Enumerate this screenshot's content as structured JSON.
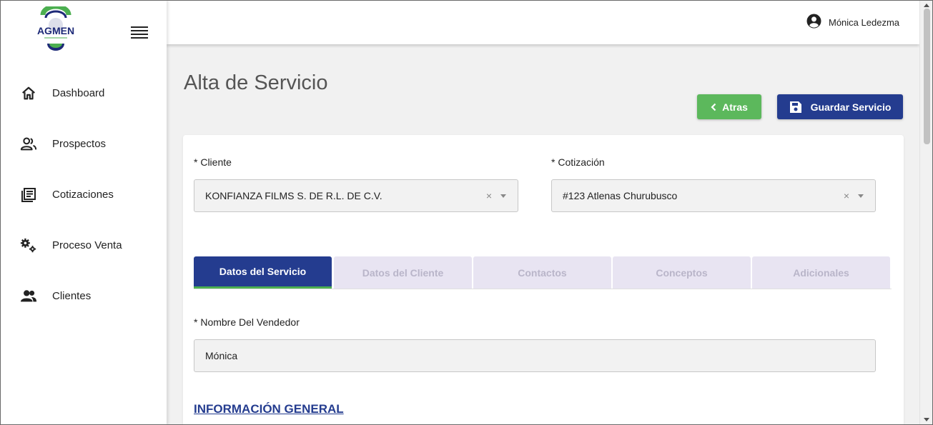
{
  "sidebar": {
    "logo_text": "AGMEN",
    "items": [
      {
        "label": "Dashboard",
        "icon": "home-icon"
      },
      {
        "label": "Prospectos",
        "icon": "people-outline-icon"
      },
      {
        "label": "Cotizaciones",
        "icon": "document-list-icon"
      },
      {
        "label": "Proceso Venta",
        "icon": "gears-icon"
      },
      {
        "label": "Clientes",
        "icon": "people-filled-icon"
      }
    ]
  },
  "topbar": {
    "user_name": "Mónica Ledezma"
  },
  "page": {
    "title": "Alta de Servicio",
    "back_label": "Atras",
    "save_label": "Guardar Servicio"
  },
  "form": {
    "cliente_label": "* Cliente",
    "cliente_value": "KONFIANZA FILMS S. DE R.L. DE C.V.",
    "cotizacion_label": "* Cotización",
    "cotizacion_value": "#123 Atlenas Churubusco",
    "clear_glyph": "×",
    "vendedor_label": "* Nombre Del Vendedor",
    "vendedor_value": "Mónica",
    "section_title": "INFORMACIÓN GENERAL"
  },
  "tabs": [
    {
      "label": "Datos del Servicio",
      "active": true
    },
    {
      "label": "Datos del Cliente",
      "active": false
    },
    {
      "label": "Contactos",
      "active": false
    },
    {
      "label": "Conceptos",
      "active": false
    },
    {
      "label": "Adicionales",
      "active": false
    }
  ],
  "colors": {
    "primary": "#243c8f",
    "success": "#5cb85c",
    "tab_inactive": "#e8e4f2",
    "active_tab_underline": "#4caf50"
  }
}
